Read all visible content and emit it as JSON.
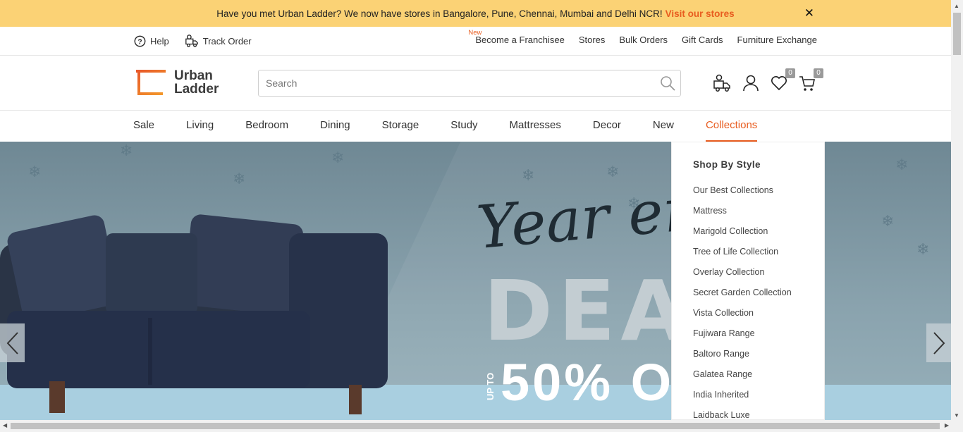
{
  "announcement": {
    "text": "Have you met Urban Ladder? We now have stores in Bangalore, Pune, Chennai, Mumbai and Delhi NCR!",
    "link": "Visit our stores",
    "close": "✕"
  },
  "utility": {
    "help": "Help",
    "track_order": "Track Order",
    "new_tag": "New",
    "links": [
      "Become a Franchisee",
      "Stores",
      "Bulk Orders",
      "Gift Cards",
      "Furniture Exchange"
    ]
  },
  "header": {
    "logo_line1": "Urban",
    "logo_line2": "Ladder",
    "search_placeholder": "Search",
    "wishlist_count": "0",
    "cart_count": "0"
  },
  "nav": {
    "items": [
      "Sale",
      "Living",
      "Bedroom",
      "Dining",
      "Storage",
      "Study",
      "Mattresses",
      "Decor",
      "New",
      "Collections"
    ],
    "active": "Collections"
  },
  "hero": {
    "script": "Year end",
    "big": "DEALS",
    "upto": "UP TO",
    "percent": "50% O"
  },
  "dropdown": {
    "heading": "Shop By Style",
    "items": [
      "Our Best Collections",
      "Mattress",
      "Marigold Collection",
      "Tree of Life Collection",
      "Overlay Collection",
      "Secret Garden Collection",
      "Vista Collection",
      "Fujiwara Range",
      "Baltoro Range",
      "Galatea Range",
      "India Inherited",
      "Laidback Luxe"
    ]
  },
  "colors": {
    "accent": "#e85c1f",
    "banner": "#fbd275"
  }
}
